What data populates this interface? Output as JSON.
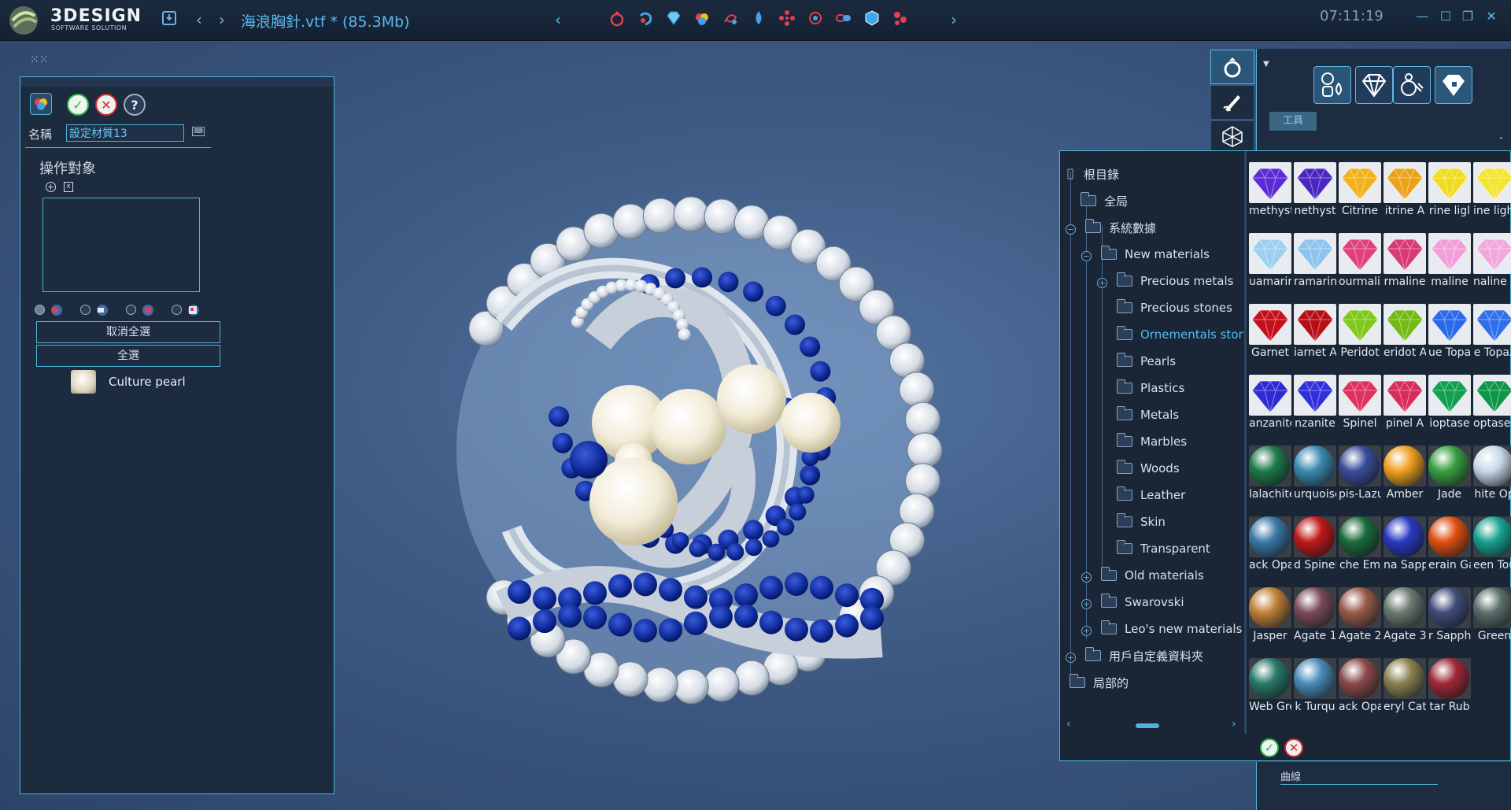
{
  "app": {
    "brand": "3DESIGN",
    "brand_sub": "SOFTWARE SOLUTION",
    "doc_title": "海浪胸針.vtf *  (85.3Mb)",
    "clock": "07:11:19"
  },
  "left_panel": {
    "name_label": "名稱",
    "name_value": "設定材質13",
    "section_title": "操作對象",
    "deselect_all": "取消全選",
    "select_all": "全選",
    "items": [
      {
        "label": "Culture pearl"
      }
    ]
  },
  "right_top": {
    "tool_tab": "工具"
  },
  "tree": {
    "items": [
      {
        "label": "根目錄"
      },
      {
        "label": "全局"
      },
      {
        "label": "系統數據"
      },
      {
        "label": "New materials"
      },
      {
        "label": "Precious metals"
      },
      {
        "label": "Precious stones"
      },
      {
        "label": "Ornementals ston"
      },
      {
        "label": "Pearls"
      },
      {
        "label": "Plastics"
      },
      {
        "label": "Metals"
      },
      {
        "label": "Marbles"
      },
      {
        "label": "Woods"
      },
      {
        "label": "Leather"
      },
      {
        "label": "Skin"
      },
      {
        "label": "Transparent"
      },
      {
        "label": "Old materials"
      },
      {
        "label": "Swarovski"
      },
      {
        "label": "Leo's new materials"
      },
      {
        "label": "用戶自定義資料夾"
      },
      {
        "label": "局部的"
      }
    ],
    "selected": "Ornementals ston",
    "selected_color": "#4fc0f0"
  },
  "materials": {
    "rows": [
      [
        {
          "n": "methyst",
          "c": "#5a2bd6"
        },
        {
          "n": "nethyst",
          "c": "#4a25c4"
        },
        {
          "n": "Citrine",
          "c": "#f2b21c"
        },
        {
          "n": "itrine A",
          "c": "#eaa318"
        },
        {
          "n": "rine ligl",
          "c": "#f0dc22"
        },
        {
          "n": "ine light",
          "c": "#f4e433"
        }
      ],
      [
        {
          "n": "uamarir",
          "c": "#9ecff0"
        },
        {
          "n": "ramarine",
          "c": "#8cc4ec"
        },
        {
          "n": "ourmalin",
          "c": "#e0407e"
        },
        {
          "n": "rmaline",
          "c": "#d83a75"
        },
        {
          "n": "maline",
          "c": "#f0a0d8"
        },
        {
          "n": "naline li",
          "c": "#f2a8dc"
        }
      ],
      [
        {
          "n": "Garnet",
          "c": "#c4101c"
        },
        {
          "n": "iarnet A",
          "c": "#b80e18"
        },
        {
          "n": "Peridot",
          "c": "#80c81c"
        },
        {
          "n": "eridot A",
          "c": "#72ba18"
        },
        {
          "n": "ue Topa",
          "c": "#2a6ae8"
        },
        {
          "n": "e Topaz",
          "c": "#2f6fea"
        }
      ],
      [
        {
          "n": "anzanite",
          "c": "#2e2ad4"
        },
        {
          "n": "nzanite",
          "c": "#3230dc"
        },
        {
          "n": "Spinel",
          "c": "#e03060"
        },
        {
          "n": "pinel A",
          "c": "#d82c5a"
        },
        {
          "n": "ioptase",
          "c": "#10a050"
        },
        {
          "n": "optase A",
          "c": "#0e9648"
        }
      ],
      [
        {
          "n": "lalachite",
          "c": "#1e7a4a"
        },
        {
          "n": "urquoise",
          "c": "#3a8ab0"
        },
        {
          "n": "pis-Lazu",
          "c": "#3a4c9a"
        },
        {
          "n": "Amber",
          "c": "#f0a020"
        },
        {
          "n": "Jade",
          "c": "#38a040"
        },
        {
          "n": "hite Op",
          "c": "#c8d8e8"
        }
      ],
      [
        {
          "n": "ack Opal",
          "c": "#3a78a8"
        },
        {
          "n": "d Spinel",
          "c": "#c01818"
        },
        {
          "n": "che Em",
          "c": "#1a6a3a"
        },
        {
          "n": "na Sapp",
          "c": "#2838c0"
        },
        {
          "n": "erain Ga",
          "c": "#e05010"
        },
        {
          "n": "een Tou",
          "c": "#18a090"
        }
      ],
      [
        {
          "n": "Jasper",
          "c": "#c08038"
        },
        {
          "n": "Agate 1",
          "c": "#7a4a58"
        },
        {
          "n": "Agate 2",
          "c": "#9a5a4a"
        },
        {
          "n": "Agate 3",
          "c": "#6a7a70"
        },
        {
          "n": "r Sapphi",
          "c": "#404c78"
        },
        {
          "n": "Green",
          "c": "#5a6e6a"
        }
      ],
      [
        {
          "n": "Web Gre",
          "c": "#287868"
        },
        {
          "n": "k Turqu",
          "c": "#4a8ab8"
        },
        {
          "n": "ack Opa",
          "c": "#8a4a48"
        },
        {
          "n": "eryl Cat",
          "c": "#8a8050"
        },
        {
          "n": "tar Rub",
          "c": "#a02838"
        }
      ]
    ]
  },
  "icons": {
    "accent": "#5bb8ee",
    "ok": "#2fb44a",
    "cancel": "#d42a2a"
  }
}
